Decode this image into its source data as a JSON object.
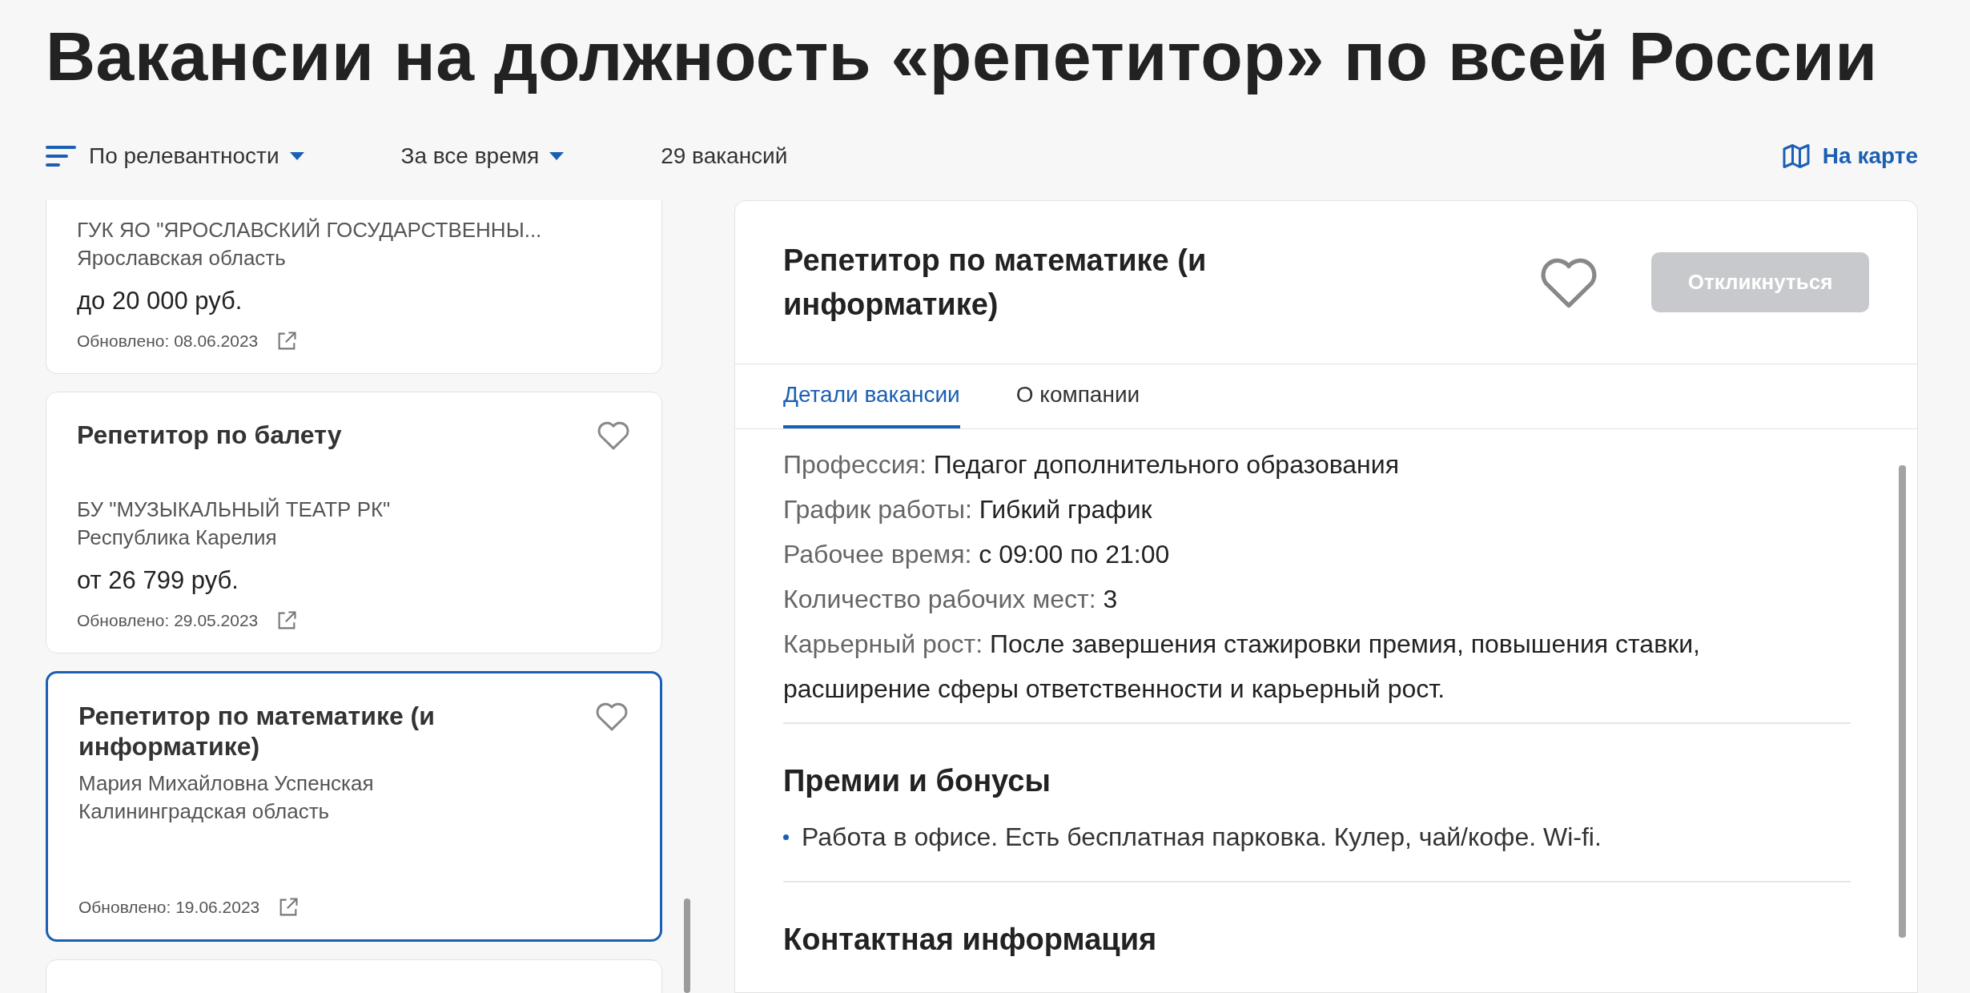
{
  "page": {
    "title": "Вакансии на должность «репетитор» по всей России"
  },
  "toolbar": {
    "sort": {
      "label": "По релевантности"
    },
    "period": {
      "label": "За все время"
    },
    "count": "29 вакансий",
    "map_link": "На карте"
  },
  "vacancies": [
    {
      "kind": "cut",
      "employer": "ГУК ЯО \"ЯРОСЛАВСКИЙ ГОСУДАРСТВЕННЫ...",
      "region": "Ярославская область",
      "salary": "до 20 000 руб.",
      "updated": "Обновлено: 08.06.2023",
      "selected": false
    },
    {
      "kind": "full",
      "title": "Репетитор по балету",
      "favorite": false,
      "employer": "БУ \"МУЗЫКАЛЬНЫЙ ТЕАТР РК\"",
      "region": "Республика Карелия",
      "salary": "от 26 799 руб.",
      "updated": "Обновлено: 29.05.2023",
      "selected": false
    },
    {
      "kind": "full",
      "title": "Репетитор по математике (и информатике)",
      "favorite": false,
      "employer": "Мария Михайловна Успенская",
      "region": "Калининградская область",
      "updated": "Обновлено: 19.06.2023",
      "selected": true
    }
  ],
  "detail": {
    "title": "Репетитор по математике (и информатике)",
    "favorite": false,
    "apply_button": {
      "label": "Откликнуться",
      "disabled": true
    },
    "tabs": [
      {
        "label": "Детали вакансии",
        "selected": true
      },
      {
        "label": "О компании",
        "selected": false
      }
    ],
    "fields": [
      {
        "label": "Профессия:",
        "value": "Педагог дополнительного образования"
      },
      {
        "label": "График работы:",
        "value": "Гибкий график"
      },
      {
        "label": "Рабочее время:",
        "value": "с 09:00 по 21:00"
      },
      {
        "label": "Количество рабочих мест:",
        "value": "3"
      },
      {
        "label": "Карьерный рост:",
        "value": "После завершения стажировки премия, повышения ставки, расширение сферы ответственности и карьерный рост."
      }
    ],
    "sections": [
      {
        "heading": "Премии и бонусы",
        "bullets": [
          "Работа в офисе. Есть бесплатная парковка. Кулер, чай/кофе. Wi-fi."
        ]
      },
      {
        "heading": "Контактная информация"
      }
    ]
  }
}
